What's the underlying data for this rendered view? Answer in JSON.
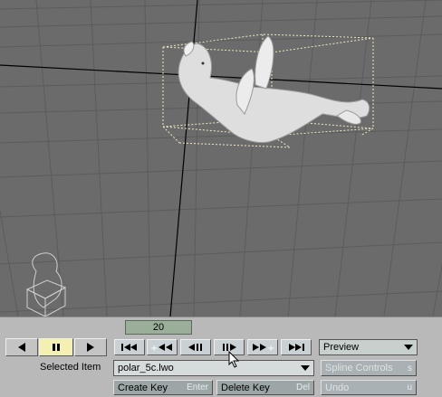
{
  "timeline": {
    "frame": "20"
  },
  "play_controls": {
    "reverse_icon": "play-reverse-icon",
    "pause_icon": "pause-icon",
    "forward_icon": "play-forward-icon"
  },
  "transport": {
    "first_icon": "first-frame-icon",
    "prev_key_icon": "previous-key-icon",
    "prev_frame_icon": "previous-frame-icon",
    "next_frame_icon": "next-frame-icon",
    "next_key_icon": "next-key-icon",
    "last_icon": "last-frame-icon"
  },
  "preview": {
    "label": "Preview"
  },
  "selected_item": {
    "label": "Selected Item",
    "value": "polar_5c.lwo"
  },
  "spline_controls": {
    "label": "Spline Controls",
    "shortcut": "s"
  },
  "create_key": {
    "label": "Create Key",
    "shortcut": "Enter"
  },
  "delete_key": {
    "label": "Delete Key",
    "shortcut": "Del"
  },
  "undo": {
    "label": "Undo",
    "shortcut": "u"
  }
}
